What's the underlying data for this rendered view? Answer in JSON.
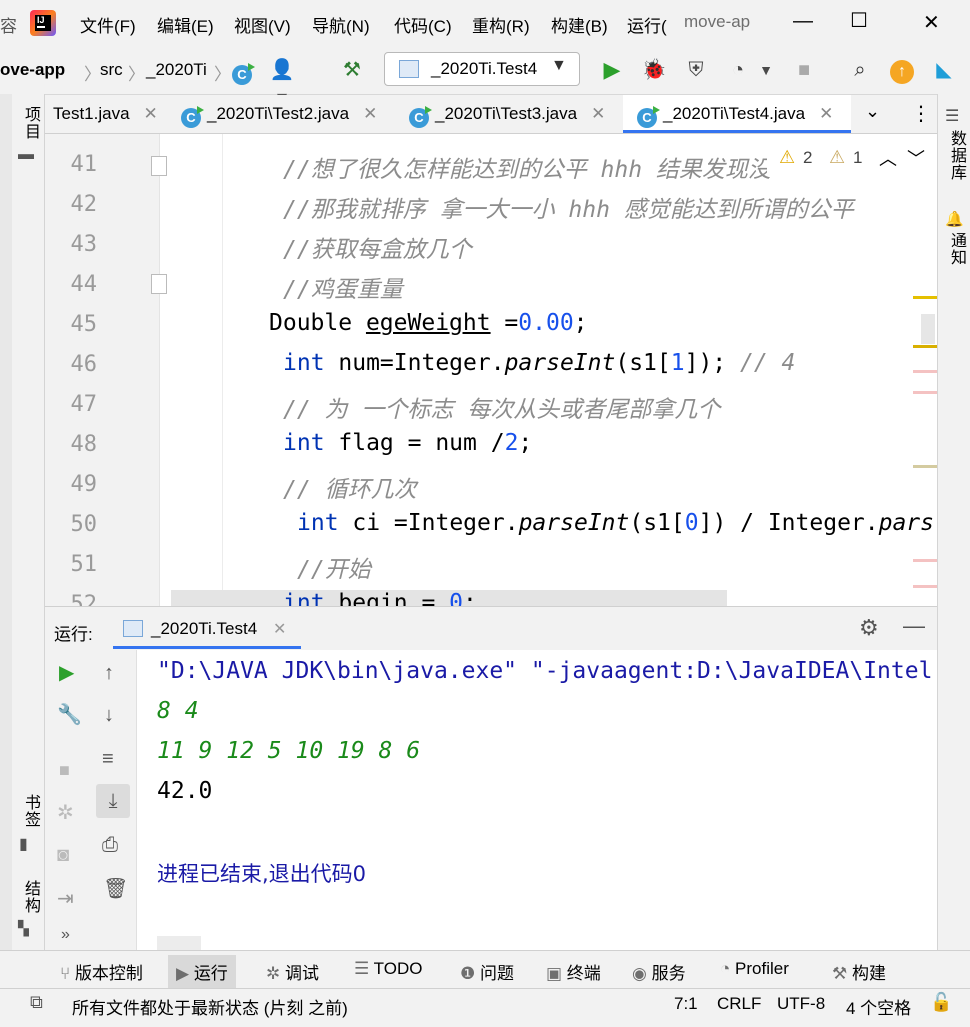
{
  "menu": {
    "partial_left": "容",
    "items": [
      "文件(F)",
      "编辑(E)",
      "视图(V)",
      "导航(N)",
      "代码(C)",
      "重构(R)",
      "构建(B)",
      "运行("
    ],
    "project_title": "move-ap"
  },
  "toolbar": {
    "breadcrumb": [
      "ove-app",
      "src",
      "_2020Ti"
    ],
    "run_config": "_2020Ti.Test4"
  },
  "left_strip": {
    "project": "项目",
    "bookmarks": "书签",
    "structure": "结构"
  },
  "right_strip": {
    "database": "数据库",
    "notifications": "通知"
  },
  "tabs": [
    {
      "label": "Test1.java",
      "active": false
    },
    {
      "label": "_2020Ti\\Test2.java",
      "active": false
    },
    {
      "label": "_2020Ti\\Test3.java",
      "active": false
    },
    {
      "label": "_2020Ti\\Test4.java",
      "active": true
    }
  ],
  "inspections": {
    "warnings": "2",
    "weak_warnings": "1"
  },
  "code": {
    "line_numbers": [
      "41",
      "42",
      "43",
      "44",
      "45",
      "46",
      "47",
      "48",
      "49",
      "50",
      "51",
      "52"
    ],
    "l41": "//想了很久怎样能达到的公平 hhh 结果发现没",
    "l42": "//那我就排序 拿一大一小 hhh 感觉能达到所谓的公平",
    "l43": "//获取每盒放几个",
    "l44": "//鸡蛋重量",
    "l45_type": "Double",
    "l45_var": "egeWeight",
    "l45_eq": " =",
    "l45_val": "0.00",
    "l45_end": ";",
    "l46_kw": "int",
    "l46_a": " num=Integer.",
    "l46_m": "parseInt",
    "l46_b": "(s1[",
    "l46_n": "1",
    "l46_c": "]); ",
    "l46_cm": "// 4",
    "l47": "// 为 一个标志 每次从头或者尾部拿几个",
    "l48_kw": "int",
    "l48_a": " flag = num /",
    "l48_n": "2",
    "l48_b": ";",
    "l49": "// 循环几次",
    "l50_kw": "int",
    "l50_a": " ci =Integer.",
    "l50_m": "parseInt",
    "l50_b": "(s1[",
    "l50_n": "0",
    "l50_c": "]) / Integer.",
    "l50_m2": "pars",
    "l51": "//开始",
    "l52_kw": "int",
    "l52_a": " begin = ",
    "l52_n": "0",
    "l52_b": ";"
  },
  "run": {
    "label": "运行:",
    "tab": "_2020Ti.Test4",
    "output": [
      "\"D:\\JAVA JDK\\bin\\java.exe\" \"-javaagent:D:\\JavaIDEA\\Intel",
      "8 4",
      "11 9 12 5 10 19 8 6",
      "42.0",
      "进程已结束,退出代码0"
    ]
  },
  "tool_tabs": [
    "版本控制",
    "运行",
    "调试",
    "TODO",
    "问题",
    "终端",
    "服务",
    "Profiler",
    "构建"
  ],
  "status": {
    "message": "所有文件都处于最新状态 (片刻 之前)",
    "position": "7:1",
    "line_sep": "CRLF",
    "encoding": "UTF-8",
    "indent": "4 个空格"
  },
  "colors": {
    "accent": "#3574f0",
    "run_green": "#2ca02c",
    "stdout_green": "#1a8a1a",
    "exit_blue": "#1a1aa6"
  }
}
